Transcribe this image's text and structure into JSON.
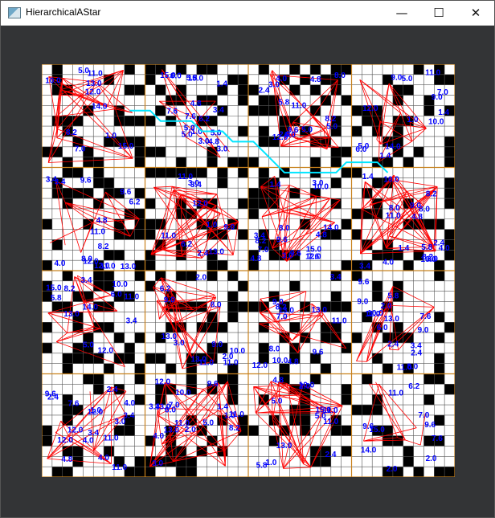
{
  "window": {
    "title": "HierarchicalAStar",
    "minimize_glyph": "—",
    "maximize_glyph": "☐",
    "close_glyph": "✕",
    "app_icon": "window-app-icon"
  },
  "grid": {
    "cells": 40,
    "cluster_size": 10,
    "seed": 7,
    "obstacle_density": 0.3,
    "cluster_line_color": "#c8821e",
    "edge_color": "#ff0000",
    "label_color": "#0000ff",
    "path_color": "#00e5ff",
    "wall_color": "#000000",
    "cell_color": "#ffffff",
    "grid_line_color": "#555555",
    "edge_labels": [
      "1.0",
      "2.0",
      "3.0",
      "4.0",
      "5.0",
      "6.0",
      "7.0",
      "8.0",
      "9.0",
      "10.0",
      "11.0",
      "12.0",
      "13.0",
      "14.0",
      "15.0",
      "1.4",
      "2.4",
      "3.4",
      "4.8",
      "5.8",
      "6.2",
      "7.6",
      "8.2",
      "9.6",
      "11.0",
      "12.0"
    ],
    "path_cells": [
      [
        8,
        4
      ],
      [
        9,
        4
      ],
      [
        10,
        4
      ],
      [
        11,
        5
      ],
      [
        12,
        5
      ],
      [
        13,
        5
      ],
      [
        14,
        5
      ],
      [
        15,
        6
      ],
      [
        16,
        6
      ],
      [
        17,
        6
      ],
      [
        18,
        7
      ],
      [
        19,
        7
      ],
      [
        20,
        7
      ],
      [
        21,
        8
      ],
      [
        22,
        9
      ],
      [
        23,
        10
      ],
      [
        24,
        10
      ],
      [
        25,
        10
      ],
      [
        26,
        10
      ],
      [
        27,
        10
      ],
      [
        28,
        10
      ],
      [
        29,
        9
      ],
      [
        30,
        9
      ],
      [
        31,
        9
      ],
      [
        32,
        9
      ],
      [
        33,
        10
      ]
    ]
  }
}
